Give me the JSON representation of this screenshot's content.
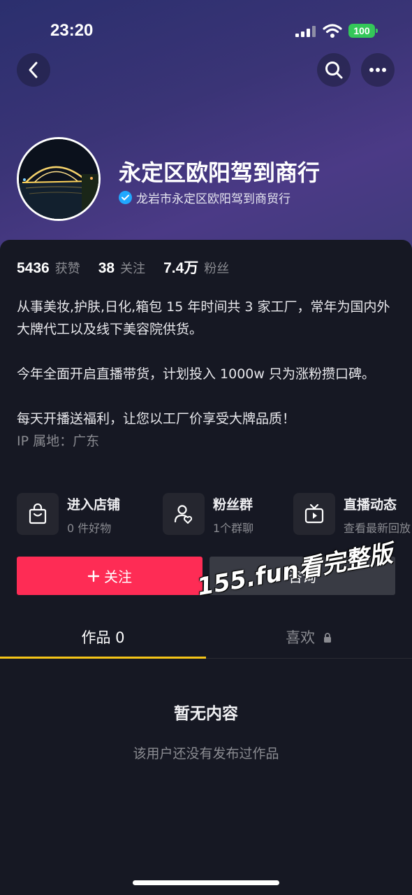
{
  "status_bar": {
    "time": "23:20",
    "battery": "100"
  },
  "header": {
    "back_icon": "chevron-left-icon",
    "search_icon": "search-icon",
    "more_icon": "more-dots-icon"
  },
  "profile": {
    "name": "永定区欧阳驾到商行",
    "verified_text": "龙岩市永定区欧阳驾到商贸行"
  },
  "stats": [
    {
      "value": "5436",
      "label": "获赞"
    },
    {
      "value": "38",
      "label": "关注"
    },
    {
      "value": "7.4万",
      "label": "粉丝"
    }
  ],
  "bio": {
    "line1": "从事美妆,护肤,日化,箱包 15 年时间共 3 家工厂，常年为国内外大牌代工以及线下美容院供货。",
    "line2": "今年全面开启直播带货，计划投入 1000w 只为涨粉攒口碑。",
    "line3": "每天开播送福利，让您以工厂价享受大牌品质！",
    "ip": "IP 属地：广东"
  },
  "features": [
    {
      "icon": "shopping-bag-icon",
      "title": "进入店铺",
      "sub": "0 件好物"
    },
    {
      "icon": "fan-group-icon",
      "title": "粉丝群",
      "sub": "1个群聊"
    },
    {
      "icon": "tv-live-icon",
      "title": "直播动态",
      "sub": "查看最新回放"
    }
  ],
  "actions": {
    "follow": "关注",
    "consult": "咨询"
  },
  "watermark": "155.fun看完整版",
  "tabs": {
    "works": "作品 0",
    "likes": "喜欢"
  },
  "empty": {
    "title": "暂无内容",
    "subtitle": "该用户还没有发布过作品"
  },
  "colors": {
    "accent": "#fe2c55",
    "tab_underline": "#f5c518",
    "verified": "#20a8ff",
    "background": "#161823"
  }
}
